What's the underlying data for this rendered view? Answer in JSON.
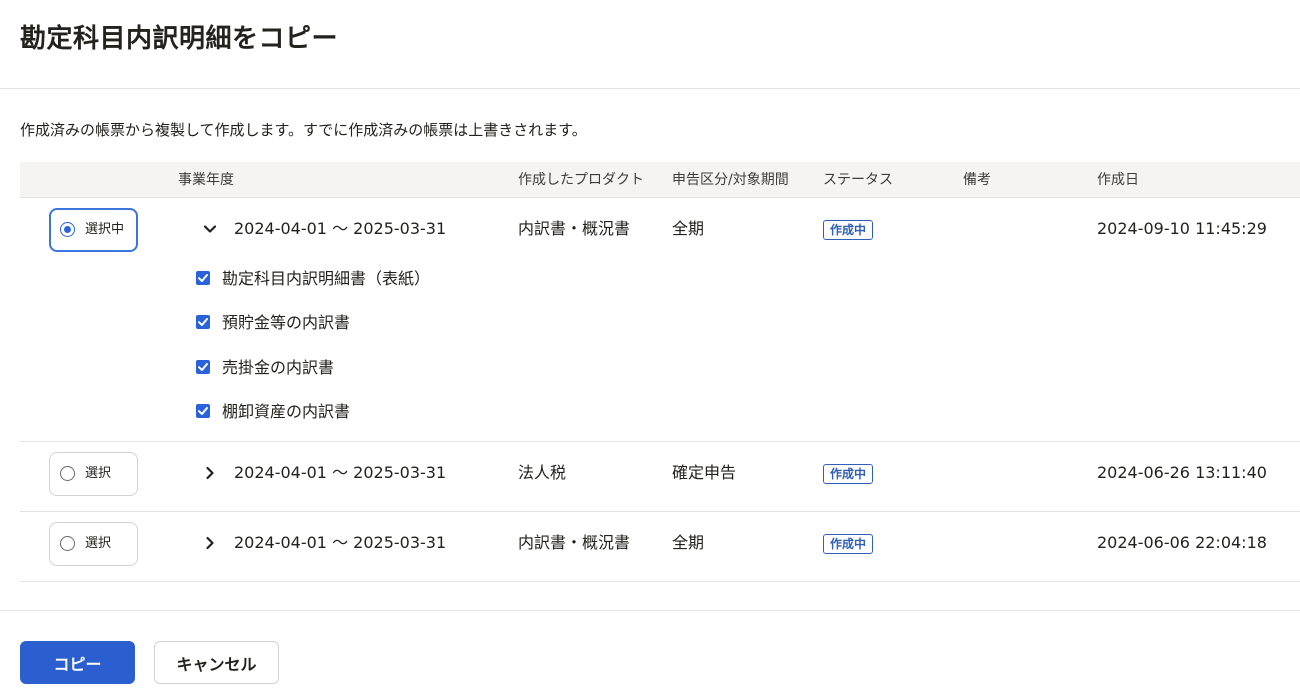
{
  "dialog": {
    "title": "勘定科目内訳明細をコピー",
    "description": "作成済みの帳票から複製して作成します。すでに作成済みの帳票は上書きされます。"
  },
  "table": {
    "columns": {
      "fiscal_year": "事業年度",
      "product": "作成したプロダクト",
      "filing_period": "申告区分/対象期間",
      "status": "ステータス",
      "notes": "備考",
      "created_at": "作成日"
    },
    "rows": [
      {
        "select_label": "選択中",
        "selected": true,
        "expanded": true,
        "period": "2024-04-01 〜 2025-03-31",
        "product": "内訳書・概況書",
        "filing": "全期",
        "status": "作成中",
        "notes": "",
        "created_at": "2024-09-10 11:45:29",
        "documents": [
          {
            "label": "勘定科目内訳明細書（表紙）",
            "checked": true
          },
          {
            "label": "預貯金等の内訳書",
            "checked": true
          },
          {
            "label": "売掛金の内訳書",
            "checked": true
          },
          {
            "label": "棚卸資産の内訳書",
            "checked": true
          }
        ]
      },
      {
        "select_label": "選択",
        "selected": false,
        "expanded": false,
        "period": "2024-04-01 〜 2025-03-31",
        "product": "法人税",
        "filing": "確定申告",
        "status": "作成中",
        "notes": "",
        "created_at": "2024-06-26 13:11:40"
      },
      {
        "select_label": "選択",
        "selected": false,
        "expanded": false,
        "period": "2024-04-01 〜 2025-03-31",
        "product": "内訳書・概況書",
        "filing": "全期",
        "status": "作成中",
        "notes": "",
        "created_at": "2024-06-06 22:04:18"
      }
    ]
  },
  "footer": {
    "copy_label": "コピー",
    "cancel_label": "キャンセル"
  },
  "colors": {
    "primary": "#2b5fcf",
    "selected_border": "#3d75de",
    "badge": "#2f5fb8",
    "header_bg": "#f5f4f2"
  },
  "icons": {
    "expanded": "chevron-down-icon",
    "collapsed": "chevron-right-icon",
    "checkbox": "checkbox-checked-icon",
    "radio": "radio-icon"
  }
}
